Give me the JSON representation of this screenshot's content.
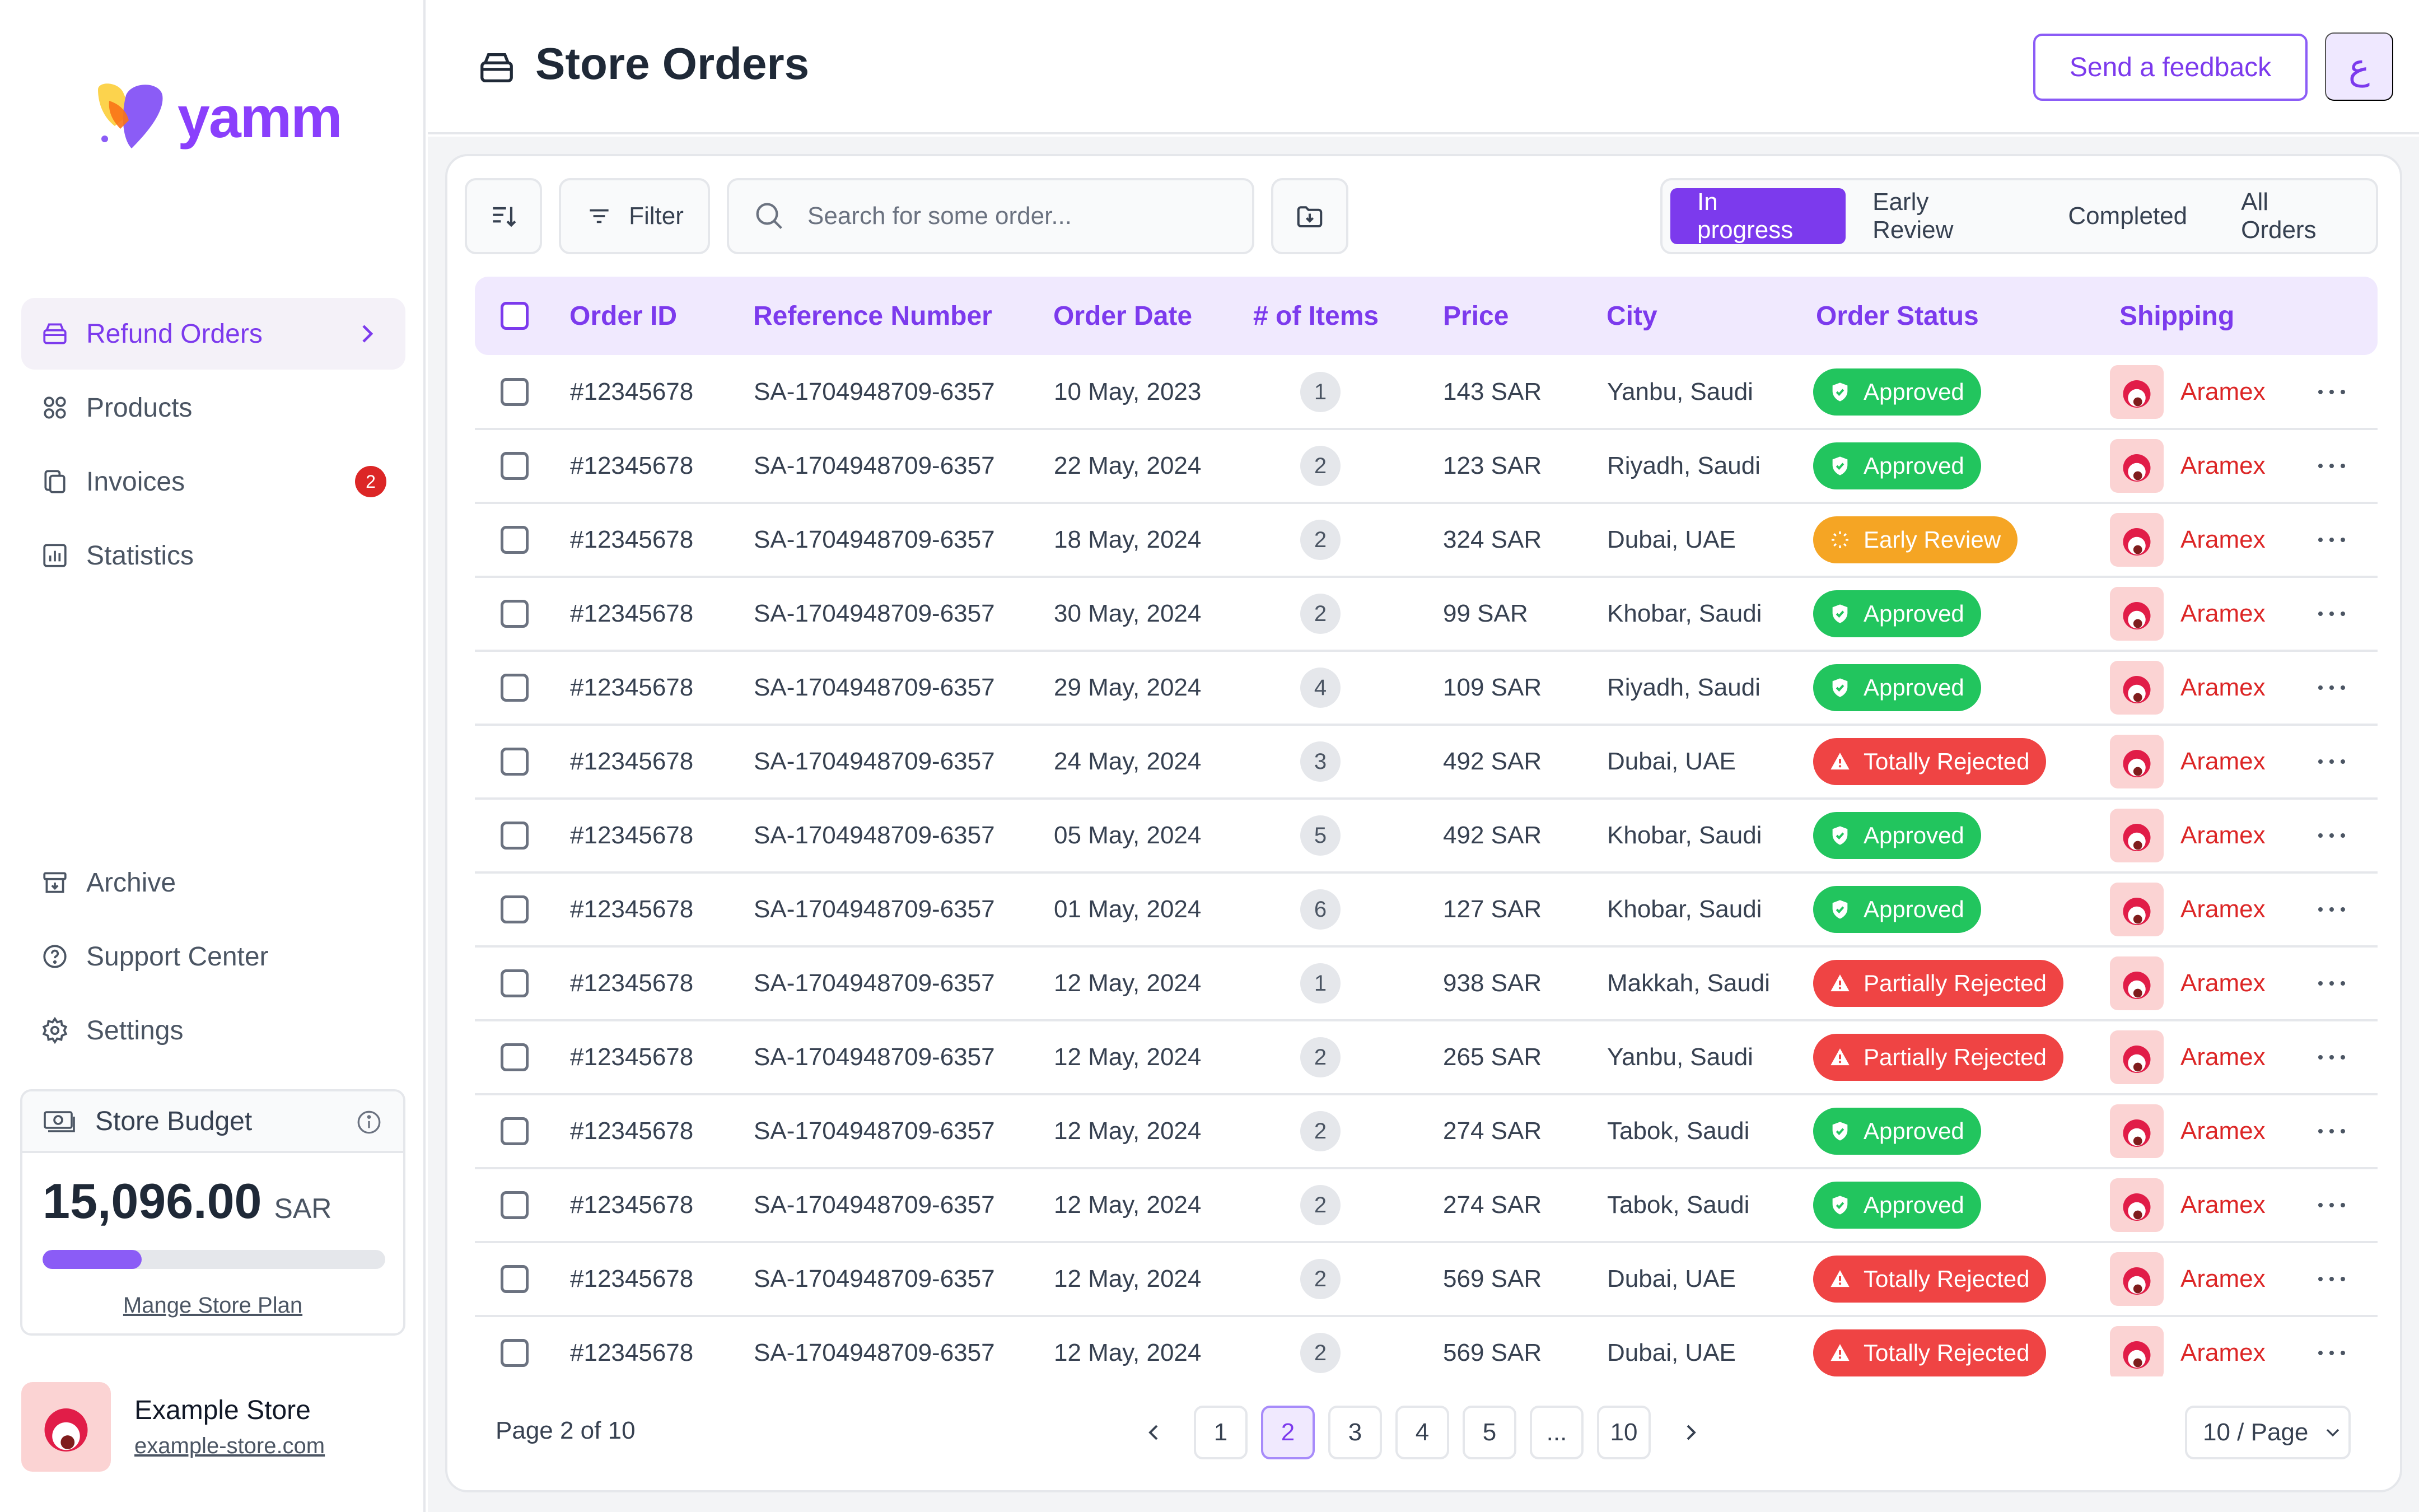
{
  "app": {
    "logo_text": "yamm"
  },
  "sidebar": {
    "items": [
      {
        "label": "Refund Orders",
        "icon": "box-icon",
        "active": true
      },
      {
        "label": "Products",
        "icon": "grid-icon"
      },
      {
        "label": "Invoices",
        "icon": "document-copy-icon",
        "badge": "2"
      },
      {
        "label": "Statistics",
        "icon": "chart-icon"
      }
    ],
    "bottom_items": [
      {
        "label": "Archive",
        "icon": "archive-icon"
      },
      {
        "label": "Support Center",
        "icon": "help-circle-icon"
      },
      {
        "label": "Settings",
        "icon": "gear-icon"
      }
    ],
    "budget": {
      "title": "Store Budget",
      "amount": "15,096.00",
      "currency": "SAR",
      "progress": 0.29,
      "link": "Mange Store Plan"
    },
    "store": {
      "name": "Example Store",
      "url": "example-store.com"
    }
  },
  "header": {
    "title": "Store Orders",
    "feedback_label": "Send a feedback",
    "language_label": "ع"
  },
  "toolbar": {
    "filter_label": "Filter",
    "search_placeholder": "Search for some order...",
    "tabs": [
      {
        "label": "In progress",
        "active": true
      },
      {
        "label": "Early Review"
      },
      {
        "label": "Completed"
      },
      {
        "label": "All Orders"
      }
    ]
  },
  "table": {
    "columns": [
      "Order ID",
      "Reference Number",
      "Order Date",
      "# of Items",
      "Price",
      "City",
      "Order Status",
      "Shipping"
    ],
    "rows": [
      {
        "id": "#12345678",
        "ref": "SA-1704948709-6357",
        "date": "10 May, 2023",
        "items": "1",
        "price": "143 SAR",
        "city": "Yanbu, Saudi",
        "status": "Approved",
        "kind": "approved",
        "shipping": "Aramex"
      },
      {
        "id": "#12345678",
        "ref": "SA-1704948709-6357",
        "date": "22 May, 2024",
        "items": "2",
        "price": "123 SAR",
        "city": "Riyadh, Saudi",
        "status": "Approved",
        "kind": "approved",
        "shipping": "Aramex"
      },
      {
        "id": "#12345678",
        "ref": "SA-1704948709-6357",
        "date": "18 May, 2024",
        "items": "2",
        "price": "324 SAR",
        "city": "Dubai,  UAE",
        "status": "Early Review",
        "kind": "review",
        "shipping": "Aramex"
      },
      {
        "id": "#12345678",
        "ref": "SA-1704948709-6357",
        "date": "30 May, 2024",
        "items": "2",
        "price": "99 SAR",
        "city": "Khobar, Saudi",
        "status": "Approved",
        "kind": "approved",
        "shipping": "Aramex"
      },
      {
        "id": "#12345678",
        "ref": "SA-1704948709-6357",
        "date": "29 May, 2024",
        "items": "4",
        "price": "109 SAR",
        "city": "Riyadh, Saudi",
        "status": "Approved",
        "kind": "approved",
        "shipping": "Aramex"
      },
      {
        "id": "#12345678",
        "ref": "SA-1704948709-6357",
        "date": "24 May, 2024",
        "items": "3",
        "price": "492 SAR",
        "city": "Dubai, UAE",
        "status": "Totally Rejected",
        "kind": "rejected",
        "shipping": "Aramex"
      },
      {
        "id": "#12345678",
        "ref": "SA-1704948709-6357",
        "date": "05 May, 2024",
        "items": "5",
        "price": "492 SAR",
        "city": "Khobar, Saudi",
        "status": "Approved",
        "kind": "approved",
        "shipping": "Aramex"
      },
      {
        "id": "#12345678",
        "ref": "SA-1704948709-6357",
        "date": "01 May, 2024",
        "items": "6",
        "price": "127 SAR",
        "city": "Khobar, Saudi",
        "status": "Approved",
        "kind": "approved",
        "shipping": "Aramex"
      },
      {
        "id": "#12345678",
        "ref": "SA-1704948709-6357",
        "date": "12 May, 2024",
        "items": "1",
        "price": "938 SAR",
        "city": "Makkah, Saudi",
        "status": "Partially Rejected",
        "kind": "rejected",
        "shipping": "Aramex"
      },
      {
        "id": "#12345678",
        "ref": "SA-1704948709-6357",
        "date": "12 May, 2024",
        "items": "2",
        "price": "265 SAR",
        "city": "Yanbu, Saudi",
        "status": "Partially Rejected",
        "kind": "rejected",
        "shipping": "Aramex"
      },
      {
        "id": "#12345678",
        "ref": "SA-1704948709-6357",
        "date": "12 May, 2024",
        "items": "2",
        "price": "274 SAR",
        "city": "Tabok, Saudi",
        "status": "Approved",
        "kind": "approved",
        "shipping": "Aramex"
      },
      {
        "id": "#12345678",
        "ref": "SA-1704948709-6357",
        "date": "12 May, 2024",
        "items": "2",
        "price": "274 SAR",
        "city": "Tabok, Saudi",
        "status": "Approved",
        "kind": "approved",
        "shipping": "Aramex"
      },
      {
        "id": "#12345678",
        "ref": "SA-1704948709-6357",
        "date": "12 May, 2024",
        "items": "2",
        "price": "569 SAR",
        "city": "Dubai, UAE",
        "status": "Totally Rejected",
        "kind": "rejected",
        "shipping": "Aramex"
      },
      {
        "id": "#12345678",
        "ref": "SA-1704948709-6357",
        "date": "12 May, 2024",
        "items": "2",
        "price": "569 SAR",
        "city": "Dubai, UAE",
        "status": "Totally Rejected",
        "kind": "rejected",
        "shipping": "Aramex"
      }
    ]
  },
  "pagination": {
    "label": "Page 2 of 10",
    "pages": [
      "1",
      "2",
      "3",
      "4",
      "5",
      "...",
      "10"
    ],
    "current": "2",
    "per_page": "10 / Page"
  },
  "colors": {
    "accent": "#7c3aed",
    "approved": "#22c55e",
    "review": "#f5a524",
    "rejected": "#ef4444",
    "shipping": "#dc2626"
  }
}
